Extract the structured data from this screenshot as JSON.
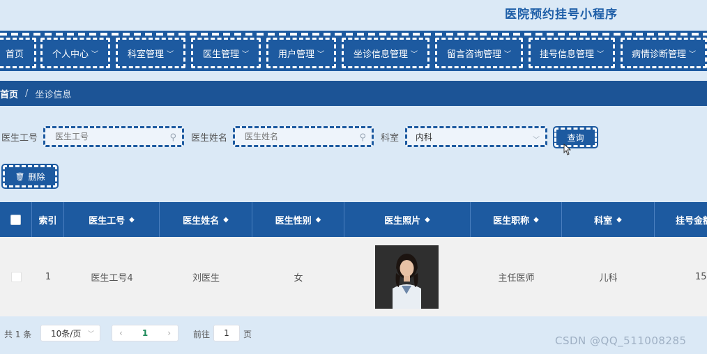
{
  "app": {
    "title": "医院预约挂号小程序"
  },
  "nav": {
    "items": [
      {
        "label": "首页",
        "chevron": ""
      },
      {
        "label": "个人中心",
        "chevron": "﹀"
      },
      {
        "label": "科室管理",
        "chevron": "﹀"
      },
      {
        "label": "医生管理",
        "chevron": "﹀"
      },
      {
        "label": "用户管理",
        "chevron": "﹀"
      },
      {
        "label": "坐诊信息管理",
        "chevron": "﹀"
      },
      {
        "label": "留言咨询管理",
        "chevron": "﹀"
      },
      {
        "label": "挂号信息管理",
        "chevron": "﹀"
      },
      {
        "label": "病情诊断管理",
        "chevron": "﹀"
      }
    ]
  },
  "breadcrumb": {
    "home": "首页",
    "separator": "/",
    "current": "坐诊信息"
  },
  "search": {
    "doctor_id_label": "医生工号",
    "doctor_id_placeholder": "医生工号",
    "doctor_name_label": "医生姓名",
    "doctor_name_placeholder": "医生姓名",
    "department_label": "科室",
    "department_value": "内科",
    "query_button": "查询"
  },
  "actions": {
    "delete_button": "删除",
    "delete_icon": "trash-icon"
  },
  "table": {
    "columns": [
      "索引",
      "医生工号",
      "医生姓名",
      "医生性别",
      "医生照片",
      "医生职称",
      "科室",
      "挂号金额"
    ],
    "rows": [
      {
        "index": "1",
        "doctor_id": "医生工号4",
        "doctor_name": "刘医生",
        "gender": "女",
        "title": "主任医师",
        "department": "儿科",
        "fee": "15"
      }
    ]
  },
  "pagination": {
    "total": "共 1 条",
    "page_size": "10条/页",
    "prev": "‹",
    "current_page": "1",
    "next": "›",
    "goto_label": "前往",
    "goto_value": "1",
    "page_suffix": "页"
  },
  "watermark": "CSDN @QQ_511008285",
  "colors": {
    "primary": "#1d5aa0",
    "background": "#dbe9f6"
  }
}
